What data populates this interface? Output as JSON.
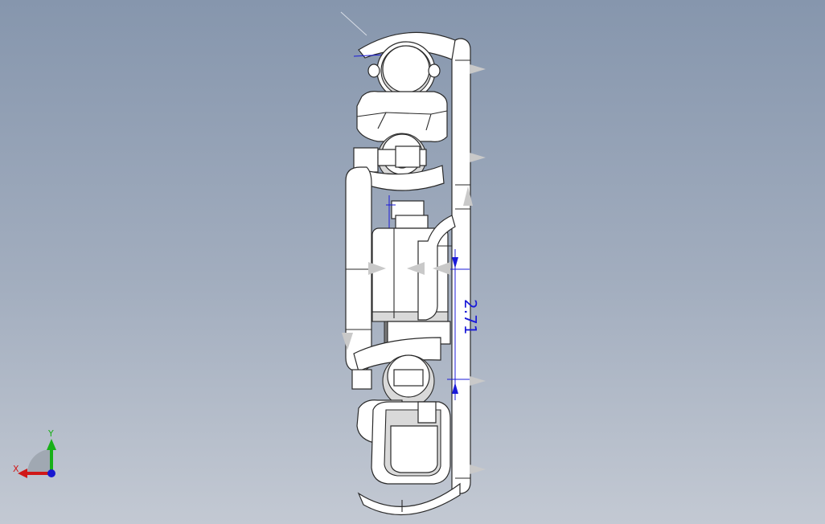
{
  "viewport": {
    "background_top": "#8696ad",
    "background_bottom": "#c3c9d3"
  },
  "model": {
    "part_color": "#ffffff",
    "edge_color": "#2a2a2a",
    "dimension_color": "#1a1ad8",
    "dimension_text": "2.71",
    "arrow_color": "#c9c9c9"
  },
  "triad": {
    "x_label": "X",
    "y_label": "Y",
    "x_color": "#d01818",
    "y_color": "#18b018",
    "z_color": "#1818d0"
  }
}
